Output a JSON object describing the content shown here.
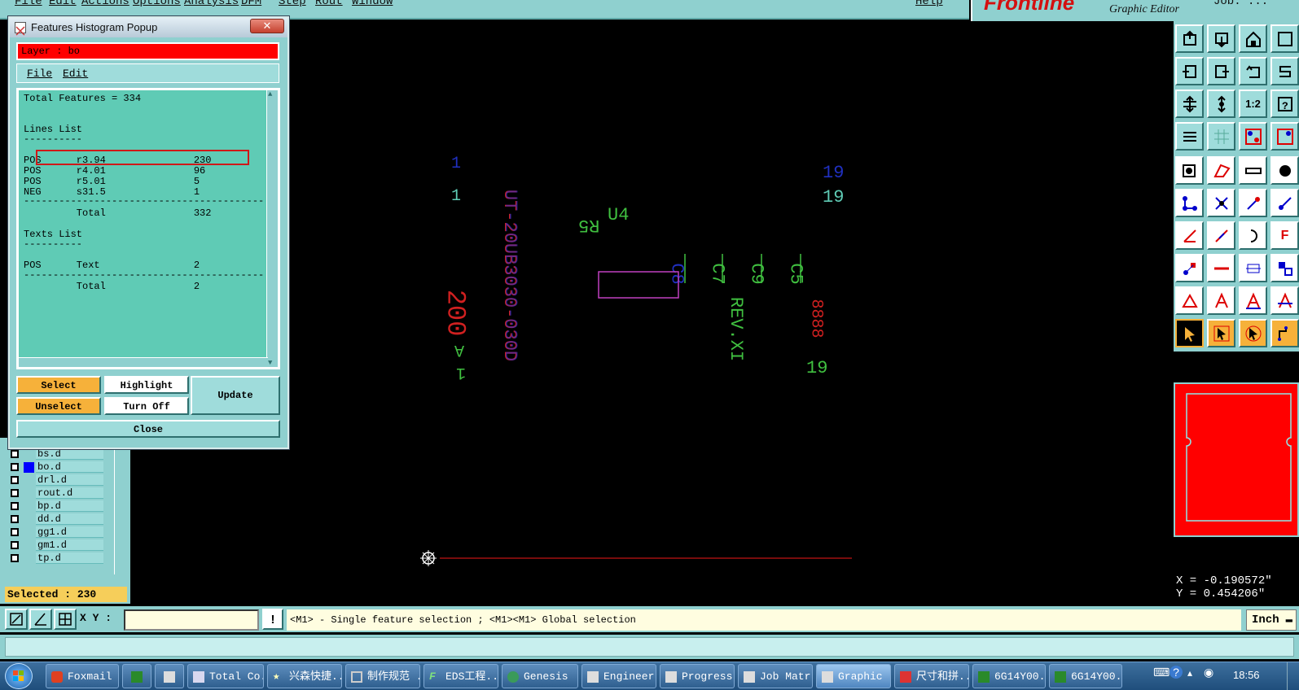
{
  "menubar": {
    "items": [
      "File",
      "Edit",
      "Actions",
      "Options",
      "Analysis",
      "DFM",
      "Step",
      "Rout",
      "Window"
    ],
    "help": "Help",
    "brand": "Frontline",
    "subtitle": "Graphic Editor",
    "topright": "Job: ..."
  },
  "popup": {
    "title": "Features Histogram Popup",
    "close_glyph": "✕",
    "layer_label": "Layer :  bo",
    "menu": {
      "file": "File",
      "edit": "Edit"
    },
    "lines": [
      "Total Features = 334",
      "",
      "",
      "Lines List",
      "----------",
      "",
      "POS      r3.94               230",
      "POS      r4.01               96",
      "POS      r5.01               5",
      "NEG      s31.5               1",
      "-----------------------------------------",
      "         Total               332",
      "",
      "Texts List",
      "----------",
      "",
      "POS      Text                2",
      "-----------------------------------------",
      "         Total               2"
    ],
    "buttons": {
      "select": "Select",
      "highlight": "Highlight",
      "update": "Update",
      "unselect": "Unselect",
      "turn_off": "Turn Off",
      "close": "Close"
    }
  },
  "layers": [
    {
      "name": "bs.d",
      "color": ""
    },
    {
      "name": "bo.d",
      "color": "#0000ff"
    },
    {
      "name": "drl.d",
      "color": ""
    },
    {
      "name": "rout.d",
      "color": ""
    },
    {
      "name": "bp.d",
      "color": ""
    },
    {
      "name": "dd.d",
      "color": ""
    },
    {
      "name": "gg1.d",
      "color": ""
    },
    {
      "name": "gm1.d",
      "color": ""
    },
    {
      "name": "tp.d",
      "color": ""
    }
  ],
  "selected_label": "Selected : 230",
  "coords": {
    "x": "X = -0.190572\"",
    "y": "Y = 0.454206\""
  },
  "cmd": {
    "xy_label": "X Y :",
    "xy_value": "",
    "message": "<M1> - Single feature selection ; <M1><M1> Global selection",
    "units": "Inch"
  },
  "canvas_text": {
    "t1": "1",
    "t2": "1",
    "t19a": "19",
    "t19b": "19",
    "u4": "U4",
    "r5": "R5",
    "c8": "C8",
    "c7": "C7",
    "c9": "C9",
    "c5": "C5",
    "rev": "REV.XI",
    "n19": "19",
    "a1": "1",
    "a2": "A",
    "z200": "200",
    "pn": "UT-20UB3030-030D",
    "pn2": "UT-20UB3030-030D",
    "c888": "8888"
  },
  "taskbar": {
    "items": [
      "Foxmail",
      "",
      "",
      "Total Co...",
      "兴森快捷...",
      "制作规范 ...",
      "EDS工程...",
      "Genesis",
      "Engineer...",
      "Progress",
      "Job Matr...",
      "Graphic ...",
      "尺寸和拼...",
      "6G14Y00...",
      "6G14Y00..."
    ],
    "clock": "18:56"
  },
  "colors": {
    "panel": "#8fd0cf",
    "list_bg": "#5fcbb5",
    "layer_red": "#ff0000",
    "accent_orange": "#f6b13a"
  }
}
